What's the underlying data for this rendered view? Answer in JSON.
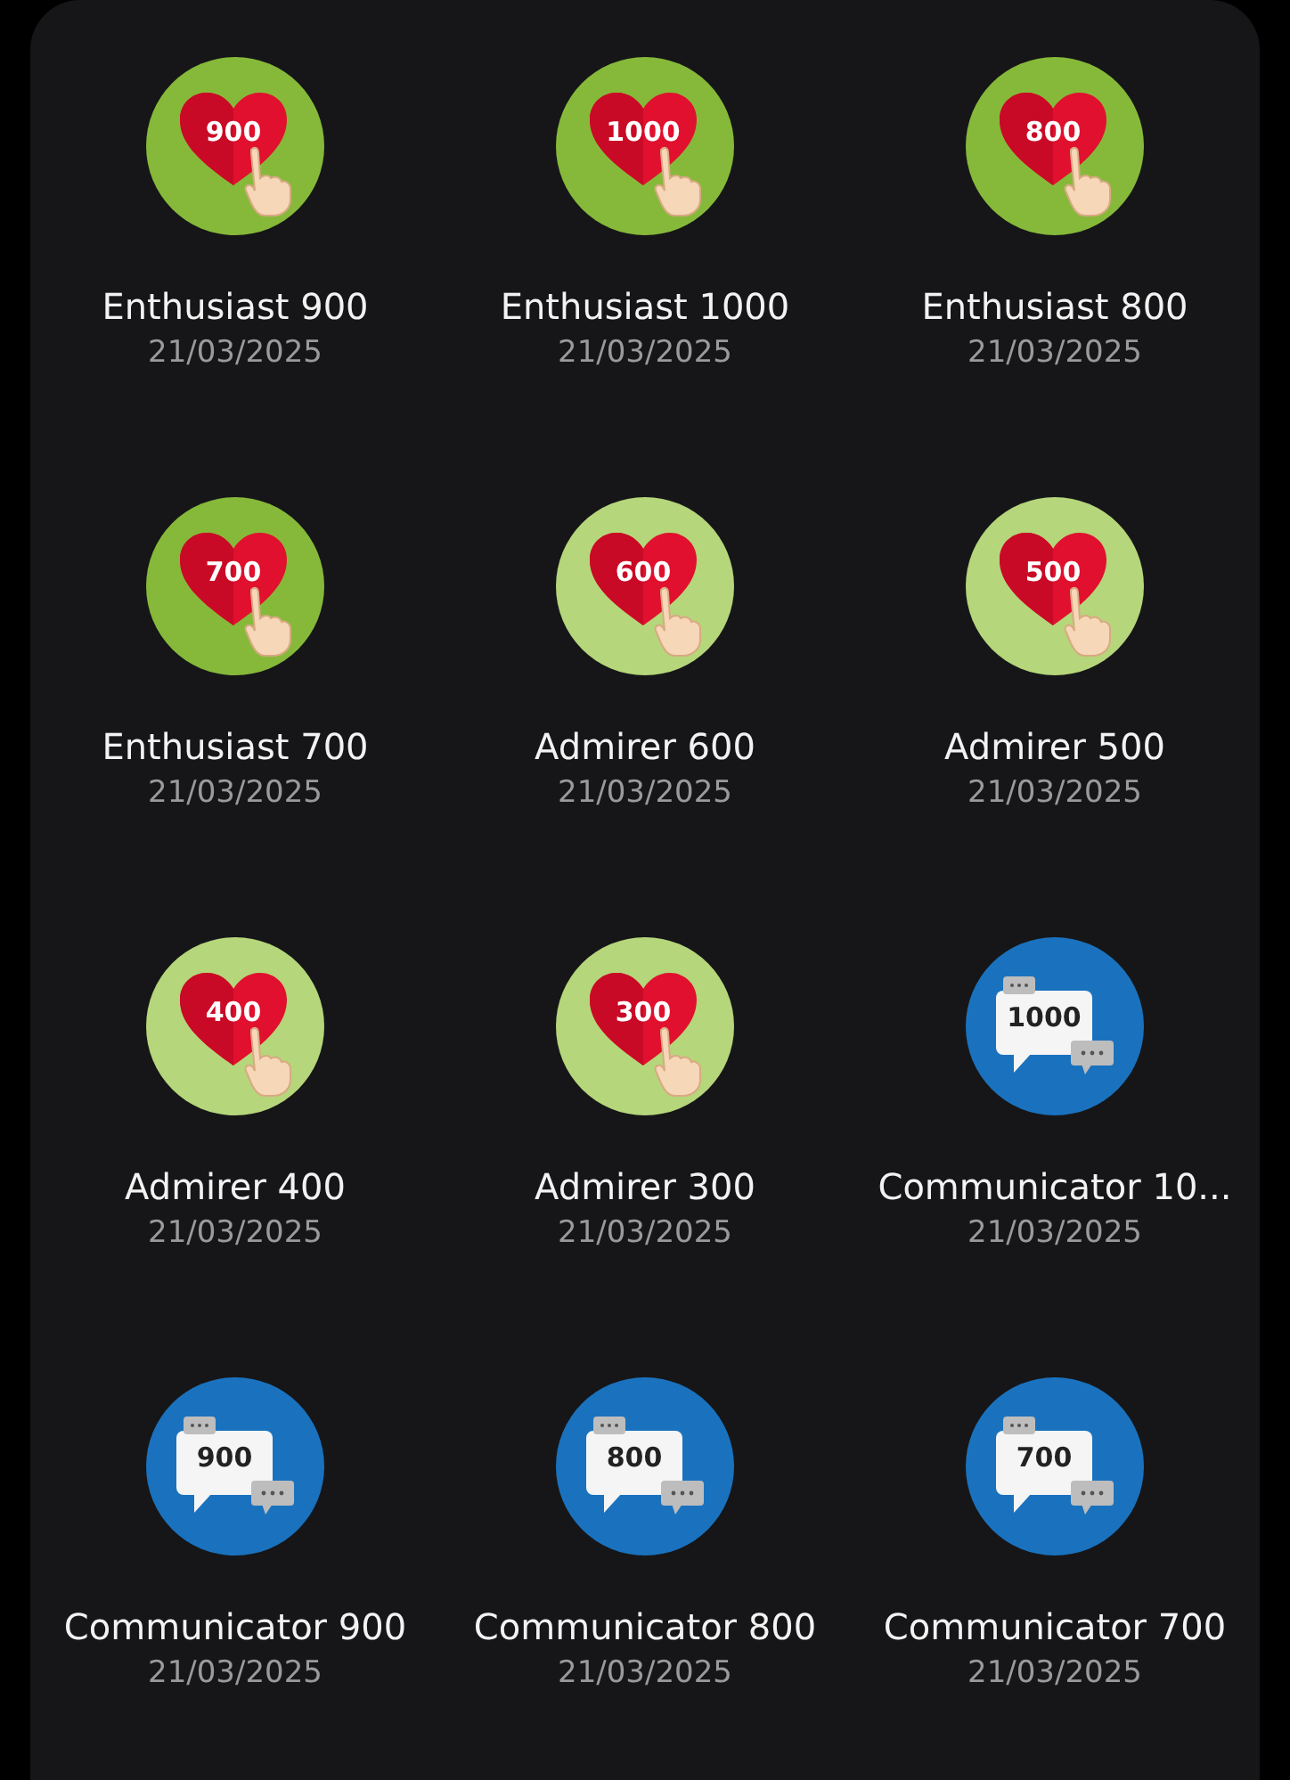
{
  "badges": [
    {
      "kind": "heart",
      "color": "#86b93a",
      "number": "900",
      "name": "Enthusiast 900",
      "date": "21/03/2025"
    },
    {
      "kind": "heart",
      "color": "#86b93a",
      "number": "1000",
      "name": "Enthusiast 1000",
      "date": "21/03/2025"
    },
    {
      "kind": "heart",
      "color": "#86b93a",
      "number": "800",
      "name": "Enthusiast 800",
      "date": "21/03/2025"
    },
    {
      "kind": "heart",
      "color": "#86b93a",
      "number": "700",
      "name": "Enthusiast 700",
      "date": "21/03/2025"
    },
    {
      "kind": "heart",
      "color": "#b5d67a",
      "number": "600",
      "name": "Admirer 600",
      "date": "21/03/2025"
    },
    {
      "kind": "heart",
      "color": "#b5d67a",
      "number": "500",
      "name": "Admirer 500",
      "date": "21/03/2025"
    },
    {
      "kind": "heart",
      "color": "#b5d67a",
      "number": "400",
      "name": "Admirer 400",
      "date": "21/03/2025"
    },
    {
      "kind": "heart",
      "color": "#b5d67a",
      "number": "300",
      "name": "Admirer 300",
      "date": "21/03/2025"
    },
    {
      "kind": "chat",
      "color": "#1a72be",
      "number": "1000",
      "name": "Communicator 10...",
      "date": "21/03/2025"
    },
    {
      "kind": "chat",
      "color": "#1a72be",
      "number": "900",
      "name": "Communicator 900",
      "date": "21/03/2025"
    },
    {
      "kind": "chat",
      "color": "#1a72be",
      "number": "800",
      "name": "Communicator 800",
      "date": "21/03/2025"
    },
    {
      "kind": "chat",
      "color": "#1a72be",
      "number": "700",
      "name": "Communicator 700",
      "date": "21/03/2025"
    }
  ]
}
